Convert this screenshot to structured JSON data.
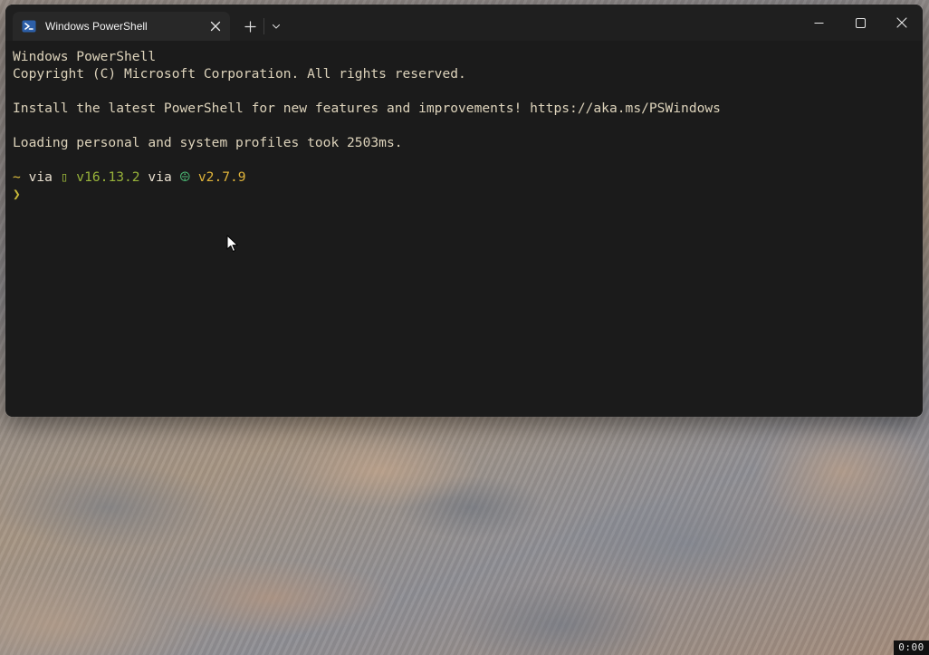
{
  "window": {
    "tab_title": "Windows PowerShell",
    "new_tab_icon": "plus-icon",
    "dropdown_icon": "chevron-down-icon",
    "controls": [
      "minimize-icon",
      "maximize-icon",
      "close-icon"
    ]
  },
  "terminal": {
    "lines": [
      "Windows PowerShell",
      "Copyright (C) Microsoft Corporation. All rights reserved.",
      "",
      "Install the latest PowerShell for new features and improvements! https://aka.ms/PSWindows",
      "",
      "Loading personal and system profiles took 2503ms.",
      ""
    ],
    "prompt": {
      "tilde": "~",
      "via_1": " via ",
      "node_version": "▯ v16.13.2",
      "via_2": " via ",
      "python_icon": "⨸",
      "python_version": " v2.7.9",
      "prompt_char": "❯"
    },
    "colors": {
      "background": "#1b1b1b",
      "text": "#ddd3bb",
      "tilde": "#e0c13f",
      "node": "#98b33a",
      "python_icon": "#4dbe77",
      "python": "#e0b43a"
    }
  },
  "overlay": {
    "timer": "0:00"
  }
}
